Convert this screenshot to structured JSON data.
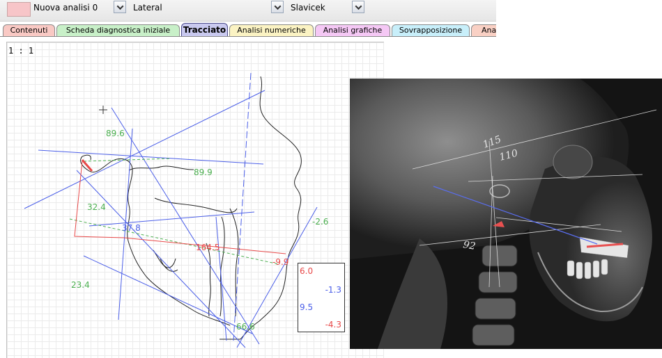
{
  "toolbar": {
    "analysis_color": "#f7c5c8",
    "analysis_select": "Nuova analisi 0",
    "view_select": "Lateral",
    "method_select": "Slavicek"
  },
  "tabs": [
    {
      "label": "Contenuti",
      "color": "#f9c9c4"
    },
    {
      "label": "Scheda diagnostica iniziale",
      "color": "#c8f0c8"
    },
    {
      "label": "Tracciato",
      "color": "#c9c9ef",
      "active": true
    },
    {
      "label": "Analisi numeriche",
      "color": "#fbf3c3"
    },
    {
      "label": "Analisi grafiche",
      "color": "#f5c8f5"
    },
    {
      "label": "Sovrapposizione",
      "color": "#c8effa"
    },
    {
      "label": "Ana",
      "color": "#f9d0c4"
    }
  ],
  "canvas": {
    "scale_label": "1 : 1",
    "angles": [
      {
        "text": "89.6",
        "color": "green"
      },
      {
        "text": "89.9",
        "color": "green"
      },
      {
        "text": "32.4",
        "color": "green"
      },
      {
        "text": "37.8",
        "color": "blue"
      },
      {
        "text": "164.5",
        "color": "red"
      },
      {
        "text": "-9.9",
        "color": "red"
      },
      {
        "text": "-2.6",
        "color": "green"
      },
      {
        "text": "23.4",
        "color": "green"
      },
      {
        "text": "66.6",
        "color": "green"
      }
    ],
    "value_box": [
      {
        "text": "6.0",
        "color": "red"
      },
      {
        "text": "-1.3",
        "color": "blue"
      },
      {
        "text": "9.5",
        "color": "blue"
      },
      {
        "text": "-4.3",
        "color": "red"
      }
    ]
  },
  "xray": {
    "handwritten": [
      "115",
      "110",
      "92"
    ]
  },
  "colors": {
    "green": "#4caf50",
    "blue": "#4a5ee8",
    "red": "#e84848",
    "tracing": "#000000"
  }
}
